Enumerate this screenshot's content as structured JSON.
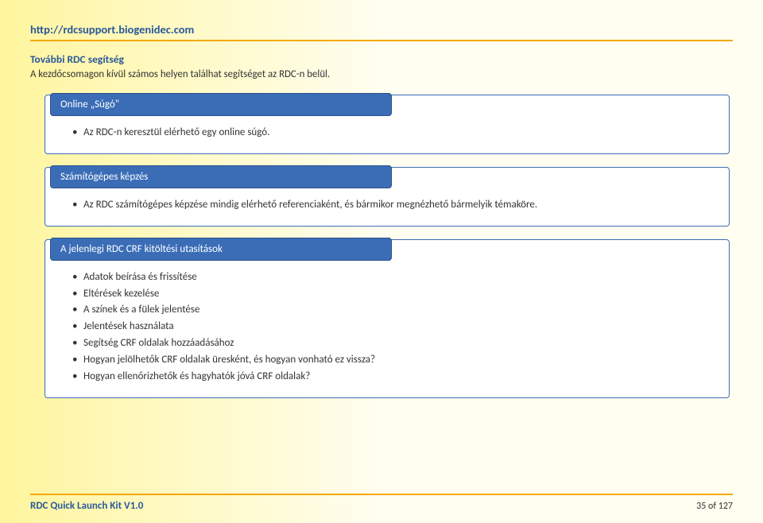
{
  "header": {
    "url": "http://rdcsupport.biogenidec.com",
    "subhead": "További RDC segítség",
    "intro": "A kezdőcsomagon kívül számos helyen találhat segítséget az RDC-n belül."
  },
  "boxes": [
    {
      "title": "Online „Súgó\"",
      "items": [
        "Az RDC-n keresztül elérhető egy online súgó."
      ]
    },
    {
      "title": "Számítógépes képzés",
      "items": [
        "Az RDC számítógépes képzése mindig elérhető referenciaként, és bármikor megnézhető bármelyik témaköre."
      ]
    },
    {
      "title": "A jelenlegi RDC CRF kitöltési utasítások",
      "items": [
        "Adatok beírása és frissítése",
        "Eltérések kezelése",
        "A színek és a fülek jelentése",
        "Jelentések használata",
        "Segítség CRF oldalak hozzáadásához",
        "Hogyan jelölhetők CRF oldalak üresként, és hogyan vonható ez vissza?",
        "Hogyan ellenőrizhetők és hagyhatók jóvá CRF oldalak?"
      ]
    }
  ],
  "footer": {
    "left": "RDC Quick Launch Kit V1.0",
    "right": "35 of 127"
  }
}
